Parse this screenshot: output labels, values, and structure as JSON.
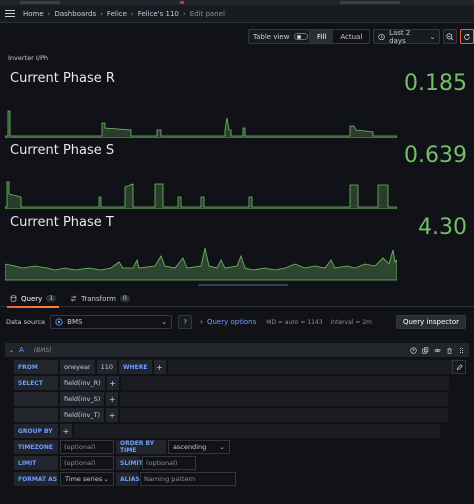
{
  "breadcrumb": [
    "Home",
    "Dashboards",
    "Felice",
    "Felice's 110",
    "Edit panel"
  ],
  "toolbar": {
    "table_view_label": "Table view",
    "fill_label": "Fill",
    "actual_label": "Actual",
    "time_range": "Last 2 days"
  },
  "panel": {
    "title": "Inverter I/Ph",
    "stats": [
      {
        "label": "Current Phase R",
        "value": "0.185"
      },
      {
        "label": "Current Phase S",
        "value": "0.639"
      },
      {
        "label": "Current Phase T",
        "value": "4.30"
      }
    ],
    "color": "#73bf69"
  },
  "tabs": [
    {
      "label": "Query",
      "count": "1"
    },
    {
      "label": "Transform",
      "count": "0"
    }
  ],
  "datasource": {
    "label": "Data source",
    "name": "BMS",
    "query_options": "Query options",
    "md": "MD = auto = 1143",
    "interval": "Interval = 2m",
    "inspector": "Query inspector"
  },
  "query": {
    "ref": "A",
    "ds_name": "(BMS)",
    "from_kw": "FROM",
    "policy": "oneyear",
    "measurement": "110",
    "where_kw": "WHERE",
    "select_kw": "SELECT",
    "fields": [
      "field(inv_R)",
      "field(inv_S)",
      "field(inv_T)"
    ],
    "groupby_kw": "GROUP BY",
    "timezone_kw": "TIMEZONE",
    "timezone_ph": "(optional)",
    "orderby_kw": "ORDER BY TIME",
    "order_value": "ascending",
    "limit_kw": "LIMIT",
    "limit_ph": "(optional)",
    "slimit_kw": "SLIMIT",
    "slimit_ph": "(optional)",
    "format_kw": "FORMAT AS",
    "format_value": "Time series",
    "alias_kw": "ALIAS",
    "alias_ph": "Naming pattern"
  }
}
